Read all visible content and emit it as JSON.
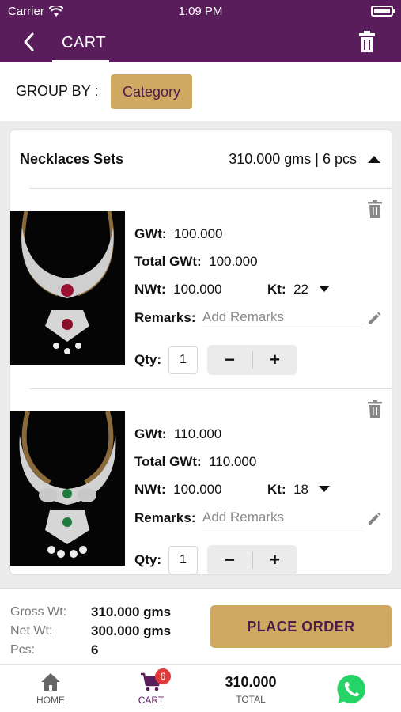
{
  "status": {
    "carrier": "Carrier",
    "time": "1:09 PM"
  },
  "header": {
    "title": "CART"
  },
  "group": {
    "label": "GROUP BY :",
    "button": "Category"
  },
  "category": {
    "name": "Necklaces Sets",
    "summary": "310.000 gms | 6 pcs"
  },
  "labels": {
    "gwt": "GWt:",
    "total_gwt": "Total GWt:",
    "nwt": "NWt:",
    "kt": "Kt:",
    "remarks": "Remarks:",
    "remarks_placeholder": "Add Remarks",
    "qty": "Qty:"
  },
  "items": [
    {
      "gwt": "100.000",
      "total_gwt": "100.000",
      "nwt": "100.000",
      "kt": "22",
      "qty": "1"
    },
    {
      "gwt": "110.000",
      "total_gwt": "110.000",
      "nwt": "100.000",
      "kt": "18",
      "qty": "1"
    }
  ],
  "stepper": {
    "minus": "−",
    "plus": "+"
  },
  "summary": {
    "gross_label": "Gross Wt:",
    "gross_value": "310.000 gms",
    "net_label": "Net Wt:",
    "net_value": "300.000 gms",
    "pcs_label": "Pcs:",
    "pcs_value": "6"
  },
  "place_order": "PLACE ORDER",
  "nav": {
    "home": "HOME",
    "cart": "CART",
    "cart_badge": "6",
    "total_value": "310.000",
    "total": "TOTAL"
  },
  "colors": {
    "brand": "#5a1d5c",
    "accent": "#cfa962",
    "badge": "#e03a3a",
    "whatsapp": "#25d366"
  }
}
